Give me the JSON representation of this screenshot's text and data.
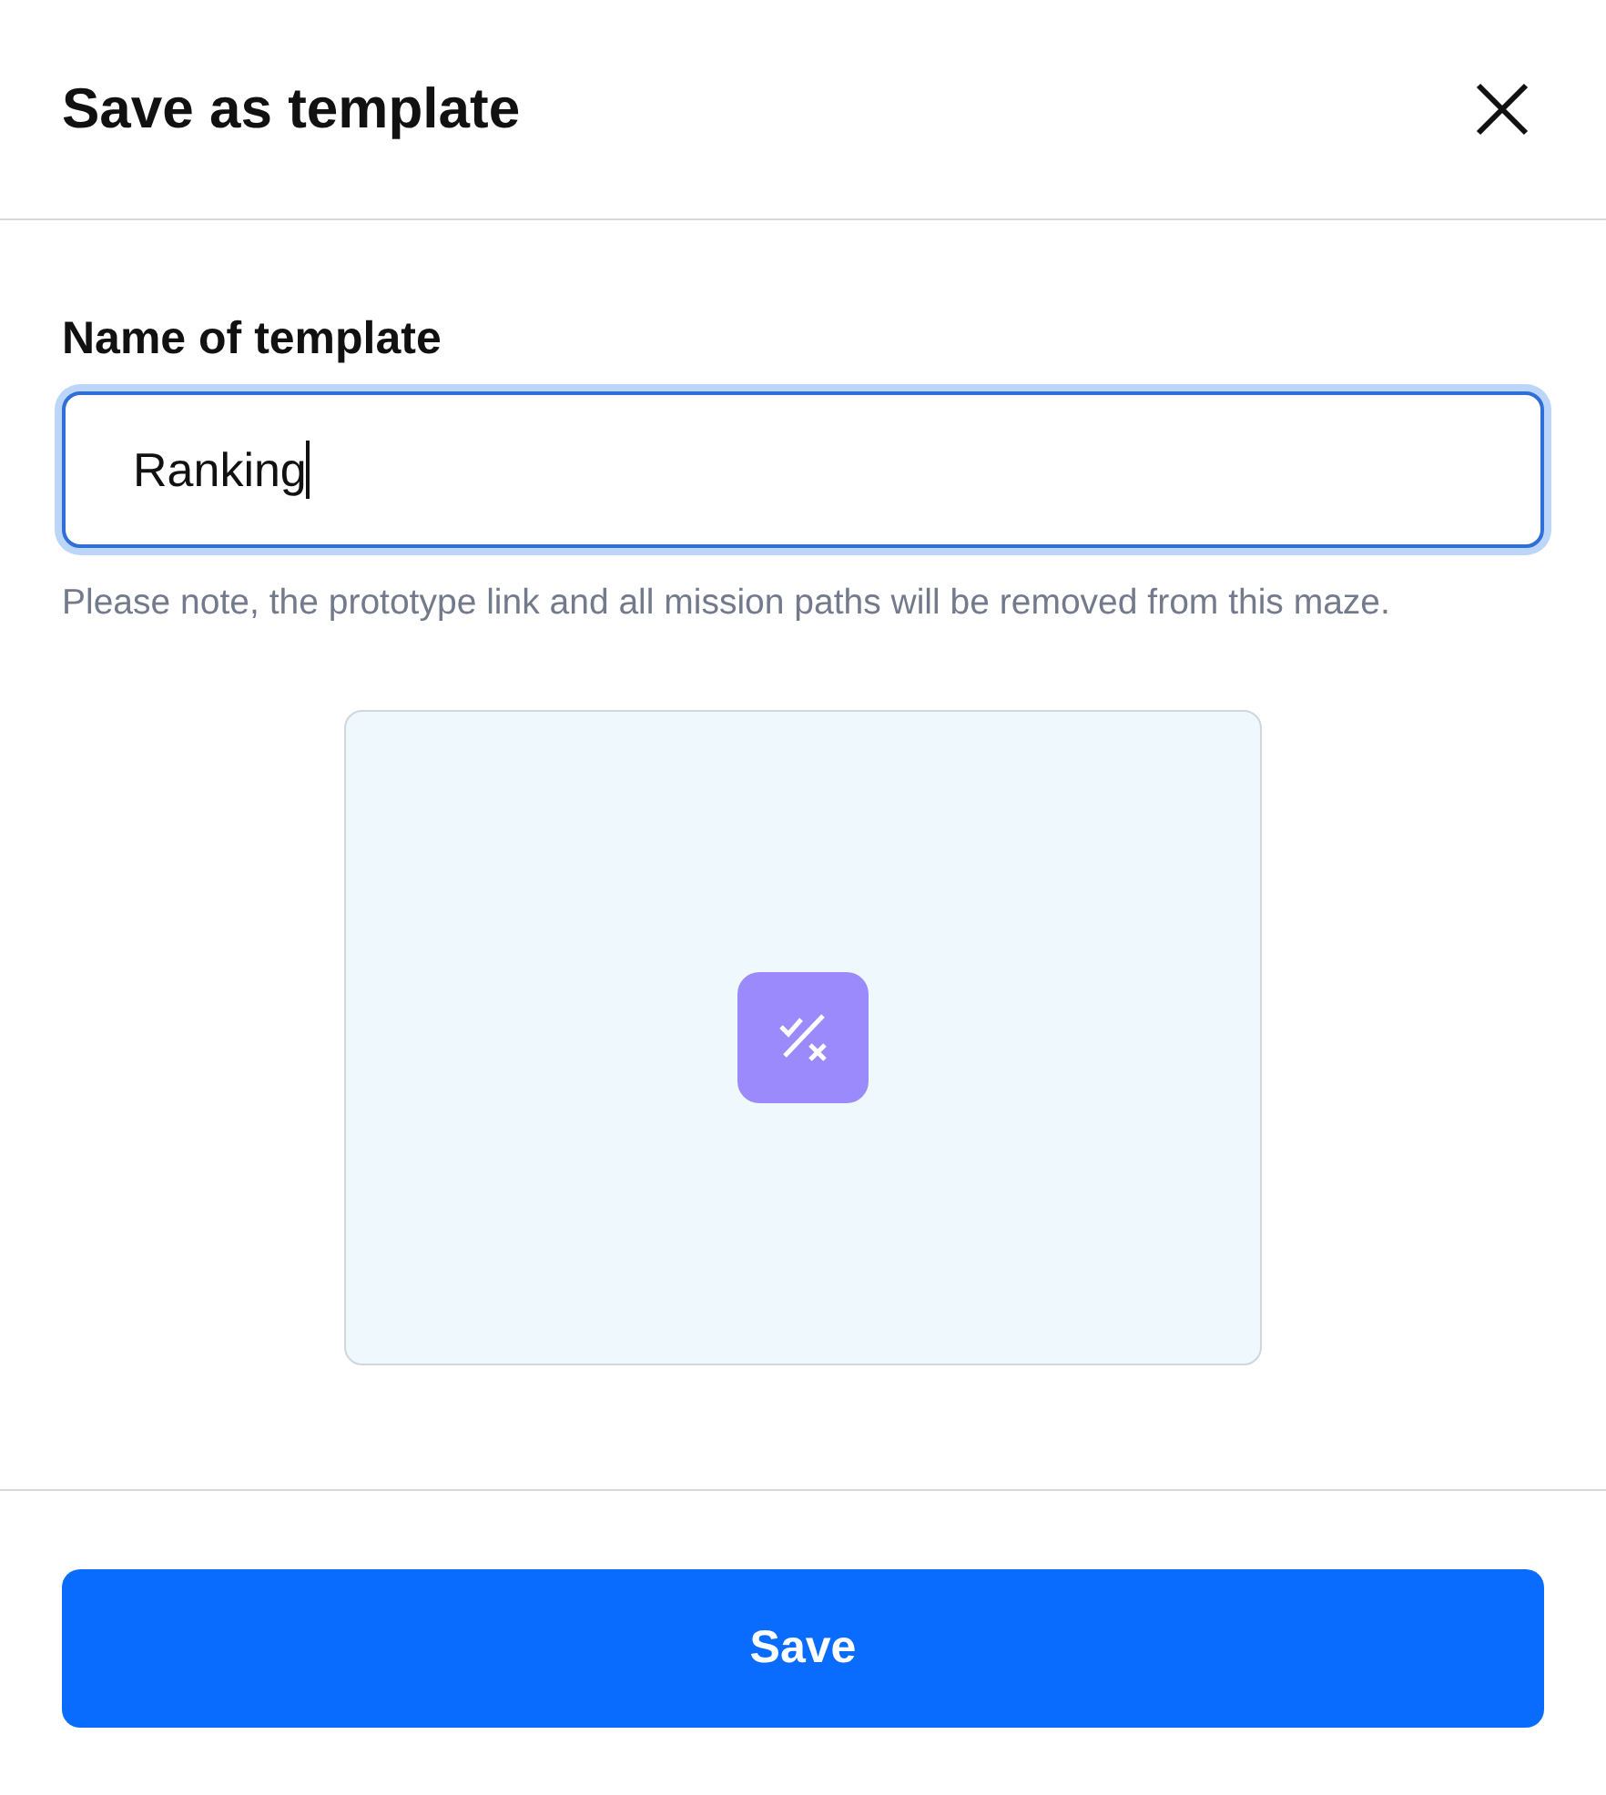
{
  "dialog": {
    "title": "Save as template"
  },
  "field": {
    "label": "Name of template",
    "value": "Ranking",
    "focused": true
  },
  "note": "Please note, the prototype link and all mission paths will be removed from this maze.",
  "buttons": [
    "Save"
  ]
}
